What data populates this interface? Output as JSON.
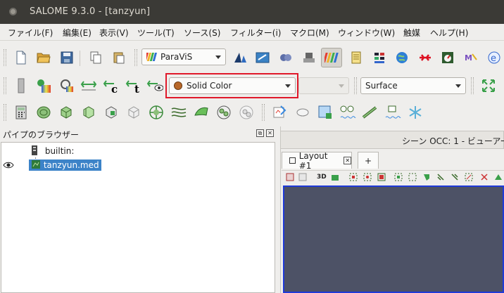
{
  "window": {
    "title": "SALOME 9.3.0 - [tanzyun]"
  },
  "menu": [
    "ファイル(F)",
    "編集(E)",
    "表示(V)",
    "ツール(T)",
    "ソース(S)",
    "フィルター(i)",
    "マクロ(M)",
    "ウィンドウ(W)",
    "触媒",
    "ヘルプ(H)"
  ],
  "toolbar1": {
    "module_select": "ParaViS"
  },
  "toolbar2": {
    "coloring_select": "Solid Color",
    "component_select": "",
    "representation_select": "Surface"
  },
  "browser": {
    "title": "パイプのブラウザー",
    "items": [
      {
        "label": "builtin:"
      },
      {
        "label": "tanzyun.med"
      }
    ]
  },
  "view": {
    "title": "シーン OCC: 1 - ビューアー",
    "tabs": [
      {
        "label": "Layout #1"
      },
      {
        "label": "+"
      }
    ],
    "toolbar_3d": "3D",
    "background_color": "#4d5266"
  },
  "colors": {
    "accent_red": "#e0192a",
    "selection_blue": "#3c83c8",
    "title_bar": "#3b3a36"
  }
}
